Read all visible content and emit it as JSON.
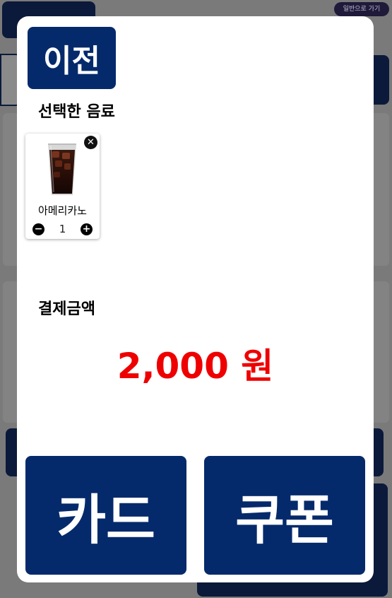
{
  "background": {
    "mode_button_label": "일반으로 가기"
  },
  "modal": {
    "prev_label": "이전",
    "selected_title": "선택한 음료",
    "items": [
      {
        "name": "아메리카노",
        "quantity": "1",
        "image": "iced-americano-image"
      }
    ],
    "payment_title": "결제금액",
    "total": "2,000 원",
    "card_label": "카드",
    "coupon_label": "쿠폰"
  },
  "colors": {
    "primary": "#052a6b",
    "total": "#ee0000"
  }
}
